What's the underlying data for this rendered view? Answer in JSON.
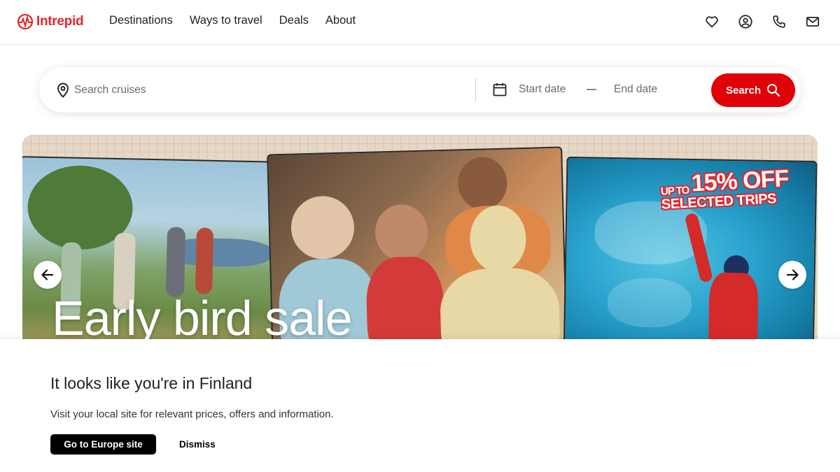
{
  "header": {
    "logo_text": "Intrepid",
    "nav": [
      "Destinations",
      "Ways to travel",
      "Deals",
      "About"
    ],
    "icons": [
      "heart-icon",
      "account-icon",
      "phone-icon",
      "mail-icon"
    ]
  },
  "search": {
    "placeholder": "Search cruises",
    "start_date": "Start date",
    "end_date": "End date",
    "button": "Search"
  },
  "hero": {
    "title": "Early bird sale",
    "promo_upto": "UP TO",
    "promo_main": "15% OFF",
    "promo_sub": "SELECTED TRIPS"
  },
  "geo_banner": {
    "title": "It looks like you're in Finland",
    "text": "Visit your local site for relevant prices, offers and information.",
    "primary_button": "Go to Europe site",
    "secondary_button": "Dismiss"
  },
  "colors": {
    "brand_red": "#e3262d",
    "search_button": "#e00008",
    "primary_button": "#000000"
  }
}
